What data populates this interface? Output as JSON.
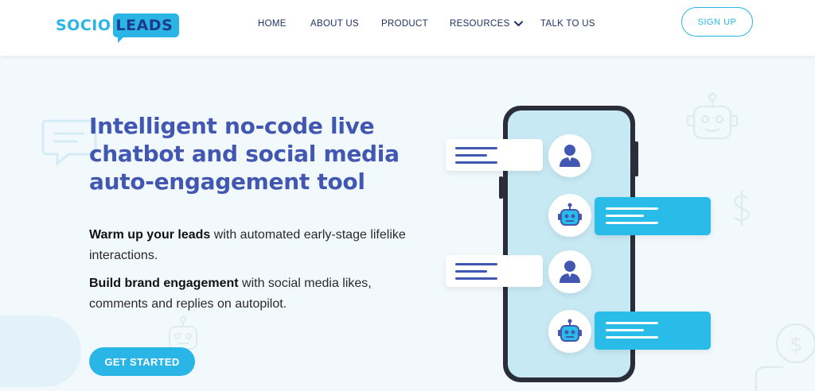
{
  "brand": {
    "logo_part1": "SOCIO",
    "logo_part2": "LEADS",
    "primary_color": "#29b6e6",
    "dark_color": "#1e3a8a",
    "headline_color": "#4257b2"
  },
  "nav": {
    "items": [
      {
        "label": "HOME"
      },
      {
        "label": "ABOUT US"
      },
      {
        "label": "PRODUCT"
      },
      {
        "label": "RESOURCES",
        "icon": "chevron-down-icon"
      },
      {
        "label": "TALK TO US"
      }
    ],
    "signup_label": "SIGN UP"
  },
  "hero": {
    "headline": "Intelligent no-code live chatbot and social media auto-engagement tool",
    "para1_bold": "Warm up your leads",
    "para1_rest": " with automated early-stage lifelike interactions.",
    "para2_bold": "Build brand engagement",
    "para2_rest": " with social media likes, comments and replies on autopilot.",
    "cta_label": "GET STARTED"
  },
  "illustration": {
    "icons": [
      "user-icon",
      "robot-icon",
      "user-icon",
      "robot-icon"
    ],
    "decorations": [
      "chat-bubble-icon",
      "robot-icon",
      "dollar-icon",
      "robot-icon",
      "coin-icon"
    ]
  }
}
